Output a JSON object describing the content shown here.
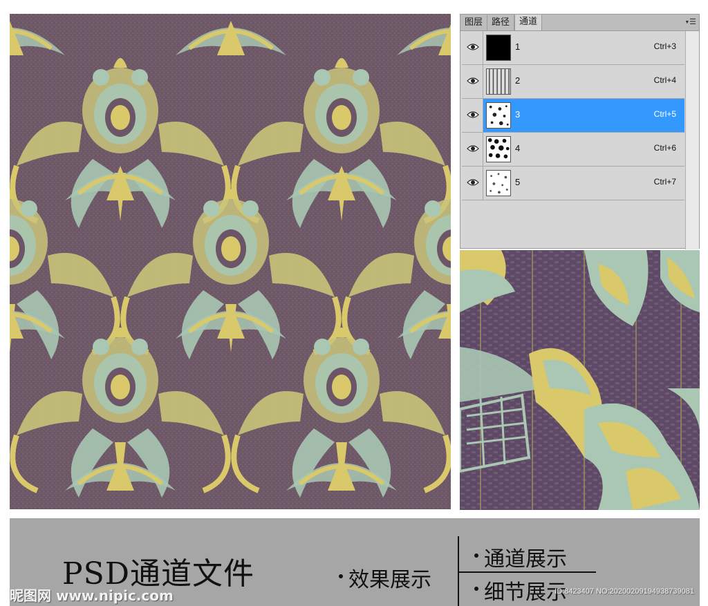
{
  "panel": {
    "tabs": [
      {
        "label": "图层"
      },
      {
        "label": "路径"
      },
      {
        "label": "通道"
      }
    ],
    "menu_icon": "panel-menu-icon",
    "channels": [
      {
        "name": "1",
        "shortcut": "Ctrl+3",
        "thumb": "solid-black"
      },
      {
        "name": "2",
        "shortcut": "Ctrl+4",
        "thumb": "stripes"
      },
      {
        "name": "3",
        "shortcut": "Ctrl+5",
        "thumb": "speckle-light",
        "selected": true
      },
      {
        "name": "4",
        "shortcut": "Ctrl+6",
        "thumb": "speckle-dense"
      },
      {
        "name": "5",
        "shortcut": "Ctrl+7",
        "thumb": "speckle-light"
      }
    ]
  },
  "footer": {
    "title": "PSD通道文件",
    "effect_label": "效果展示",
    "channel_label": "通道展示",
    "detail_label": "细节展示",
    "watermark_site": "昵图网 www.nipic.com",
    "watermark_id": "ID:8423407 NO:20200209194938739081"
  },
  "colors": {
    "background_purple": "#6b5566",
    "motif_yellow": "#d9c96a",
    "motif_mint": "#a9c7b2",
    "selected_blue": "#3399ff",
    "footer_gray": "#a6a6a6"
  }
}
